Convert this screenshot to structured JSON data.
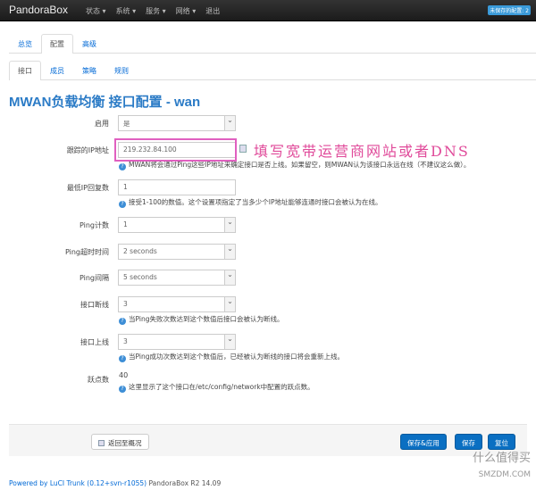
{
  "nav": {
    "brand": "PandoraBox",
    "items": [
      "状态 ▾",
      "系统 ▾",
      "服务 ▾",
      "网络 ▾",
      "退出"
    ],
    "badge": "未保存的配置: 2"
  },
  "tabs1": [
    "总览",
    "配置",
    "高级"
  ],
  "tabs2": [
    "接口",
    "成员",
    "策略",
    "规则"
  ],
  "title": "MWAN负载均衡 接口配置 - wan",
  "fields": {
    "enable": {
      "label": "启用",
      "value": "是"
    },
    "track_ip": {
      "label": "跟踪的IP地址",
      "value": "219.232.84.100",
      "help": "MWAN将会通过Ping这些IP地址来确定接口是否上线。如果留空，则MWAN认为该接口永远在线（不建议这么做）。"
    },
    "reliability": {
      "label": "最低IP回复数",
      "value": "1",
      "help": "接受1-100的数值。这个设置项指定了当多少个IP地址能够连通时接口会被认为在线。"
    },
    "count": {
      "label": "Ping计数",
      "value": "1"
    },
    "timeout": {
      "label": "Ping超时时间",
      "value": "2 seconds"
    },
    "interval": {
      "label": "Ping间隔",
      "value": "5 seconds"
    },
    "down": {
      "label": "接口断线",
      "value": "3",
      "help": "当Ping失败次数达到这个数值后接口会被认为断线。"
    },
    "up": {
      "label": "接口上线",
      "value": "3",
      "help": "当Ping成功次数达到这个数值后，已经被认为断线的接口将会重新上线。"
    },
    "metric": {
      "label": "跃点数",
      "value": "40",
      "help": "这里显示了这个接口在/etc/config/network中配置的跃点数。"
    }
  },
  "annotation": "填写宽带运营商网站或者DNS",
  "buttons": {
    "back": "返回至概况",
    "save_apply": "保存&应用",
    "save": "保存",
    "reset": "复位"
  },
  "footer": {
    "link": "Powered by LuCI Trunk (0.12+svn-r1055)",
    "version": "PandoraBox R2 14.09"
  },
  "watermark": {
    "text": "什么值得买",
    "site": "SMZDM.COM"
  }
}
